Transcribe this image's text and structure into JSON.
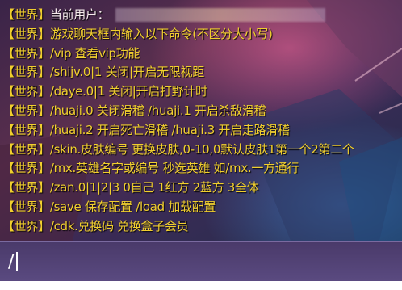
{
  "colors": {
    "tag": "#f1cf2e",
    "message": "#f1cf2e",
    "input_bar": "#544477",
    "background": "#2b1838"
  },
  "chat": {
    "lines": [
      {
        "tag": "【世界】",
        "text": "当前用户："
      },
      {
        "tag": "【世界】",
        "text": "游戏聊天框内输入以下命令(不区分大小写)"
      },
      {
        "tag": "【世界】",
        "text": "/vip 查看vip功能"
      },
      {
        "tag": "【世界】",
        "text": "/shijv.0|1 关闭|开启无限视距"
      },
      {
        "tag": "【世界】",
        "text": "/daye.0|1 关闭|开启打野计时"
      },
      {
        "tag": "【世界】",
        "text": "/huaji.0 关闭滑稽 /huaji.1 开启杀敌滑稽"
      },
      {
        "tag": "【世界】",
        "text": "/huaji.2 开启死亡滑稽 /huaji.3 开启走路滑稽"
      },
      {
        "tag": "【世界】",
        "text": "/skin.皮肤编号 更换皮肤,0-10,0默认皮肤1第一个2第二个"
      },
      {
        "tag": "【世界】",
        "text": "/mx.英雄名字或编号 秒选英雄 如/mx.一方通行"
      },
      {
        "tag": "【世界】",
        "text": "/zan.0|1|2|3  0自己 1红方 2蓝方 3全体"
      },
      {
        "tag": "【世界】",
        "text": "/save 保存配置  /load 加载配置"
      },
      {
        "tag": "【世界】",
        "text": "/cdk.兑换码   兑换盒子会员"
      }
    ]
  },
  "input": {
    "value": "/"
  }
}
